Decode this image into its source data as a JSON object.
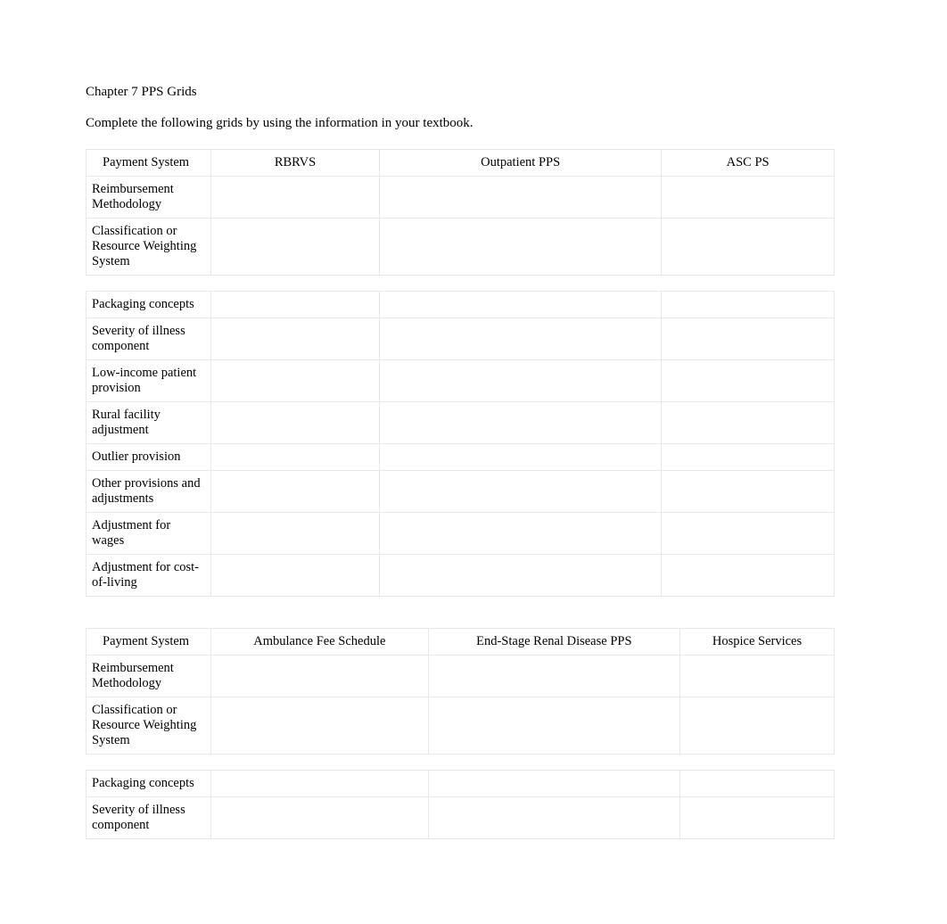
{
  "title": "Chapter 7 PPS Grids",
  "instructions": "Complete the following grids by using the information in your textbook.",
  "table1": {
    "headers": [
      "Payment System",
      "RBRVS",
      "Outpatient PPS",
      "ASC PS"
    ],
    "rows": [
      "Reimbursement Methodology",
      "Classification or Resource Weighting System",
      "",
      "Packaging concepts",
      "Severity of illness component",
      "Low-income patient provision",
      "Rural facility adjustment",
      "Outlier provision",
      "Other provisions and adjustments",
      "Adjustment for wages",
      "Adjustment for cost-of-living"
    ]
  },
  "table2": {
    "headers": [
      "Payment System",
      "Ambulance Fee Schedule",
      "End-Stage Renal Disease PPS",
      "Hospice Services"
    ],
    "rows": [
      "Reimbursement Methodology",
      "Classification or Resource Weighting System",
      "",
      "Packaging concepts",
      "Severity of illness component"
    ]
  }
}
